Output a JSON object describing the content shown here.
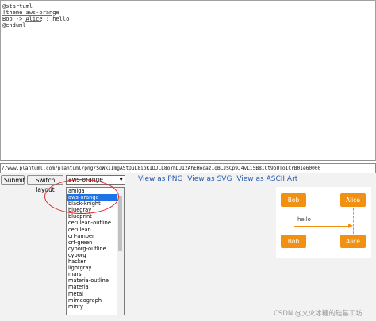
{
  "editor": {
    "lines": [
      "@startuml",
      "!theme aws-orange",
      "Bob -> Alice : hello",
      "@enduml"
    ]
  },
  "url": "//www.plantuml.com/plantuml/png/SoWkIImgAStDuL8ioKIDJLL8oYhDJIzAhEHooazIqBLJSCp9J4vLi5B8ICt9oUToICrB0Ie60000",
  "toolbar": {
    "submit_label": "Submit",
    "switch_label": "Switch layout",
    "theme_value": "aws-orange",
    "theme_arrow": "▼"
  },
  "links": {
    "png": "View as PNG",
    "svg": "View as SVG",
    "ascii": "View as ASCII Art"
  },
  "dropdown": {
    "options": [
      "amiga",
      "aws-orange",
      "black-knight",
      "bluegray",
      "blueprint",
      "cerulean-outline",
      "cerulean",
      "crt-amber",
      "crt-green",
      "cyborg-outline",
      "cyborg",
      "hacker",
      "lightgray",
      "mars",
      "materia-outline",
      "materia",
      "metal",
      "mimeograph",
      "minty"
    ],
    "selected_index": 1
  },
  "diagram": {
    "participants": [
      "Bob",
      "Alice"
    ],
    "message": "hello",
    "accent_color": "#f29111"
  },
  "watermark": "CSDN @文火冰糖的硅基工坊"
}
